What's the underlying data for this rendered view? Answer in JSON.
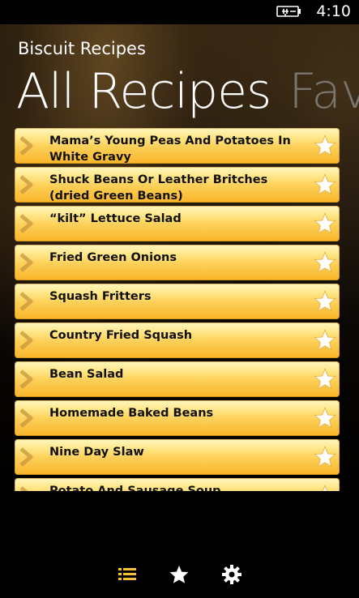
{
  "status": {
    "time": "4:10",
    "battery_icon": "battery-charging-icon"
  },
  "header": {
    "app_title": "Biscuit Recipes",
    "pivot_active": "All Recipes",
    "pivot_next": "Fave"
  },
  "recipes": [
    {
      "name": "Mama’s Young Peas And Potatoes In White Gravy"
    },
    {
      "name": "Shuck Beans Or Leather Britches (dried Green Beans)"
    },
    {
      "name": "“kilt” Lettuce Salad"
    },
    {
      "name": "Fried Green Onions"
    },
    {
      "name": "Squash Fritters"
    },
    {
      "name": "Country Fried Squash"
    },
    {
      "name": "Bean Salad"
    },
    {
      "name": "Homemade Baked Beans"
    },
    {
      "name": "Nine Day Slaw"
    },
    {
      "name": "Potato And Sausage Soup"
    }
  ],
  "app_bar": {
    "buttons": [
      "list-icon",
      "star-icon",
      "settings-icon"
    ]
  },
  "colors": {
    "item_top": "#fff6c0",
    "item_bottom": "#f9b52a",
    "app_bar_accent": "#f5c033",
    "inactive_pivot": "#7a766e"
  }
}
